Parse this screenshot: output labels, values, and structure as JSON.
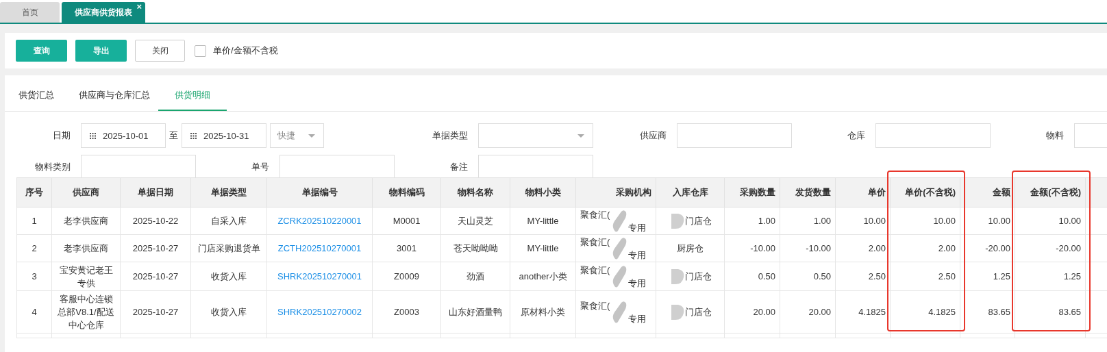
{
  "page_tabs": [
    {
      "label": "首页",
      "selected": false
    },
    {
      "label": "供应商供货报表",
      "selected": true,
      "close_glyph": "×"
    }
  ],
  "toolbar": {
    "buttons": [
      {
        "label": "查询",
        "kind": "primary"
      },
      {
        "label": "导出",
        "kind": "primary"
      },
      {
        "label": "关闭",
        "kind": "plain"
      }
    ],
    "tax_toggle": {
      "label": "单价/金额不含税",
      "checked": false
    }
  },
  "report_tabs": [
    {
      "label": "供货汇总",
      "selected": false
    },
    {
      "label": "供应商与仓库汇总",
      "selected": false
    },
    {
      "label": "供货明细",
      "selected": true
    }
  ],
  "filters": [
    {
      "kind": "date-range",
      "label": "日期",
      "from": "2025-10-01",
      "separator": "至",
      "to": "2025-10-31",
      "quick": "快捷"
    },
    {
      "kind": "select",
      "label": "单据类型"
    },
    {
      "kind": "text",
      "label": "供应商"
    },
    {
      "kind": "text",
      "label": "仓库"
    },
    {
      "kind": "text",
      "label": "物料"
    },
    {
      "kind": "text",
      "label": "物料类别"
    },
    {
      "kind": "text",
      "label": "单号"
    },
    {
      "kind": "text",
      "label": "备注"
    }
  ],
  "table": {
    "columns": [
      {
        "label": "序号",
        "highlighted": false
      },
      {
        "label": "供应商",
        "highlighted": false
      },
      {
        "label": "单据日期",
        "highlighted": false
      },
      {
        "label": "单据类型",
        "highlighted": false
      },
      {
        "label": "单据编号",
        "highlighted": false
      },
      {
        "label": "物料编码",
        "highlighted": false
      },
      {
        "label": "物料名称",
        "highlighted": false
      },
      {
        "label": "物料小类",
        "highlighted": false
      },
      {
        "label": "采购机构",
        "highlighted": false
      },
      {
        "label": "入库仓库",
        "highlighted": false
      },
      {
        "label": "采购数量",
        "highlighted": false
      },
      {
        "label": "发货数量",
        "highlighted": false
      },
      {
        "label": "单价",
        "highlighted": false
      },
      {
        "label": "单价(不含税)",
        "highlighted": true
      },
      {
        "label": "金额",
        "highlighted": false
      },
      {
        "label": "金额(不含税)",
        "highlighted": true
      }
    ],
    "rows": [
      {
        "no": "1",
        "supplier": "老李供应商",
        "date": "2025-10-22",
        "type": "自采入库",
        "doc": "ZCRK202510220001",
        "code": "M0001",
        "name": "天山灵芝",
        "category": "MY-little",
        "org": {
          "lines": [
            "聚食汇(",
            "专用"
          ],
          "redacted": true
        },
        "warehouse": {
          "text": "门店仓",
          "redacted": true
        },
        "purchase_qty": "1.00",
        "ship_qty": "1.00",
        "price": "10.00",
        "price_ex_tax": "10.00",
        "amount": "10.00",
        "amount_ex_tax": "10.00"
      },
      {
        "no": "2",
        "supplier": "老李供应商",
        "date": "2025-10-27",
        "type": "门店采购退货单",
        "doc": "ZCTH202510270001",
        "code": "3001",
        "name": "苍天呦呦呦",
        "category": "MY-little",
        "org": {
          "lines": [
            "聚食汇(",
            "专用"
          ],
          "redacted": true
        },
        "warehouse": {
          "text": "厨房仓",
          "redacted": false
        },
        "purchase_qty": "-10.00",
        "ship_qty": "-10.00",
        "price": "2.00",
        "price_ex_tax": "2.00",
        "amount": "-20.00",
        "amount_ex_tax": "-20.00"
      },
      {
        "no": "3",
        "supplier": "宝安黄记老王专供",
        "date": "2025-10-27",
        "type": "收货入库",
        "doc": "SHRK202510270001",
        "code": "Z0009",
        "name": "劲酒",
        "category": "another小类",
        "org": {
          "lines": [
            "聚食汇(",
            "专用"
          ],
          "redacted": true
        },
        "warehouse": {
          "text": "门店仓",
          "redacted": true
        },
        "purchase_qty": "0.50",
        "ship_qty": "0.50",
        "price": "2.50",
        "price_ex_tax": "2.50",
        "amount": "1.25",
        "amount_ex_tax": "1.25"
      },
      {
        "no": "4",
        "supplier": "客服中心连锁总部V8.1/配送中心仓库",
        "date": "2025-10-27",
        "type": "收货入库",
        "doc": "SHRK202510270002",
        "code": "Z0003",
        "name": "山东好酒量鸭",
        "category": "原材料小类",
        "org": {
          "lines": [
            "聚食汇(",
            "专用"
          ],
          "redacted": true
        },
        "warehouse": {
          "text": "门店仓",
          "redacted": true
        },
        "purchase_qty": "20.00",
        "ship_qty": "20.00",
        "price": "4.1825",
        "price_ex_tax": "4.1825",
        "amount": "83.65",
        "amount_ex_tax": "83.65"
      }
    ]
  }
}
